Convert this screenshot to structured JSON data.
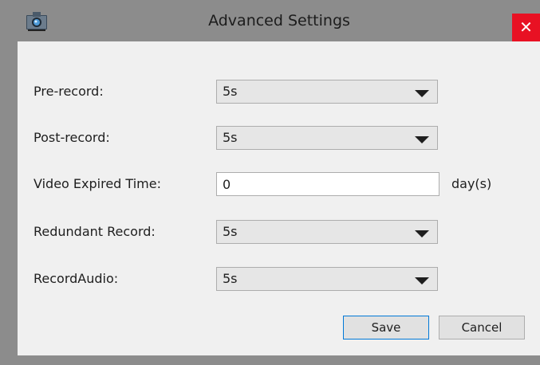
{
  "window": {
    "title": "Advanced Settings",
    "close_glyph": "✕",
    "app_icon": "camera-icon"
  },
  "form": {
    "pre_record": {
      "label": "Pre-record:",
      "value": "5s"
    },
    "post_record": {
      "label": "Post-record:",
      "value": "5s"
    },
    "video_expired": {
      "label": "Video Expired Time:",
      "value": "0",
      "unit": "day(s)"
    },
    "redundant_record": {
      "label": "Redundant Record:",
      "value": "5s"
    },
    "record_audio": {
      "label": "RecordAudio:",
      "value": "5s"
    }
  },
  "buttons": {
    "save": "Save",
    "cancel": "Cancel"
  },
  "colors": {
    "titlebar": "#8c8c8c",
    "content_bg": "#f0f0f0",
    "close_red": "#e81123",
    "primary_border": "#0078d7"
  }
}
